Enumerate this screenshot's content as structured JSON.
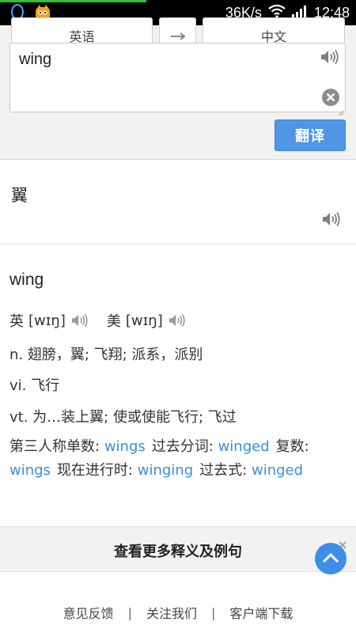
{
  "status_bar": {
    "speed": "36K/s",
    "time": "12:48",
    "left_icons": [
      "qq-icon",
      "app-mascot-icon"
    ],
    "right_icons": [
      "wifi-icon",
      "signal-icon"
    ],
    "progress": 0.41
  },
  "input": {
    "source_lang": "英语",
    "target_lang": "中文",
    "text": "wing",
    "translate_label": "翻译"
  },
  "result": {
    "translation": "翼"
  },
  "dict": {
    "word": "wing",
    "uk_label": "英",
    "uk_phonetic": "[wɪŋ]",
    "us_label": "美",
    "us_phonetic": "[wɪŋ]",
    "definitions": [
      "n. 翅膀，翼; 飞翔; 派系，派别",
      "vi. 飞行",
      "vt. 为…装上翼; 使或使能飞行; 飞过"
    ],
    "forms": {
      "third_person_label": "第三人称单数:",
      "third_person": "wings",
      "past_participle_label": "过去分词:",
      "past_participle": "winged",
      "plural_label": "复数:",
      "plural": "wings",
      "present_participle_label": "现在进行时:",
      "present_participle": "winging",
      "past_label": "过去式:",
      "past": "winged"
    }
  },
  "more": {
    "label": "查看更多释义及例句"
  },
  "footer": {
    "feedback": "意见反馈",
    "sep1": "|",
    "follow": "关注我们",
    "sep2": "|",
    "download": "客户端下载"
  },
  "colors": {
    "accent": "#4f97e5",
    "link": "#3b8ee0",
    "status_bg": "#000000",
    "panel_bg": "#f1f1f1"
  }
}
